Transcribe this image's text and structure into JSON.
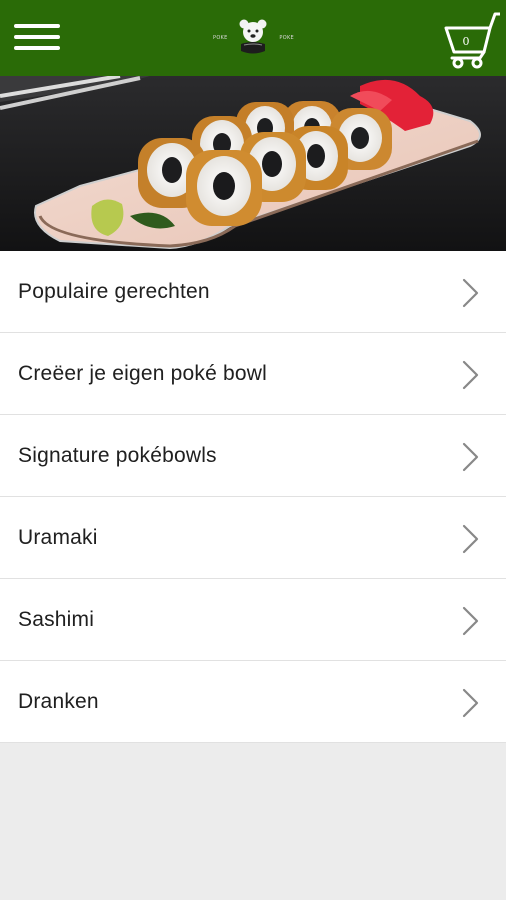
{
  "header": {
    "logo_left": "POKE",
    "logo_right": "POKE",
    "cart_count": "0"
  },
  "icons": {
    "menu": "hamburger-menu-icon",
    "logo": "bear-mascot-logo",
    "cart": "shopping-cart-icon",
    "chevron": "chevron-right-icon"
  },
  "hero": {
    "alt": "sushi rolls on a plate"
  },
  "menu": {
    "items": [
      {
        "label": "Populaire gerechten"
      },
      {
        "label": "Creëer je eigen poké bowl"
      },
      {
        "label": "Signature pokébowls"
      },
      {
        "label": "Uramaki"
      },
      {
        "label": "Sashimi"
      },
      {
        "label": "Dranken"
      }
    ]
  },
  "colors": {
    "header_bg": "#2a6b07",
    "page_bg": "#ececec",
    "list_bg": "#ffffff",
    "text": "#202020",
    "divider": "#e1e1e1"
  }
}
